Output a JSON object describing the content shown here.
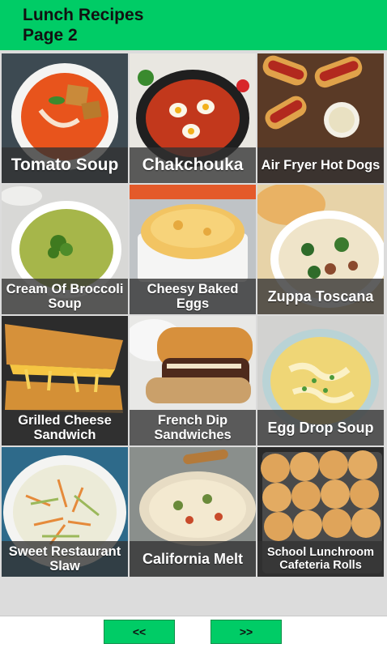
{
  "header": {
    "line1": "Lunch Recipes",
    "line2": "Page 2"
  },
  "recipes": [
    {
      "name": "Tomato Soup"
    },
    {
      "name": "Chakchouka"
    },
    {
      "name": "Air Fryer Hot Dogs"
    },
    {
      "name": "Cream Of Broccoli Soup"
    },
    {
      "name": "Cheesy Baked Eggs"
    },
    {
      "name": "Zuppa Toscana"
    },
    {
      "name": "Grilled Cheese Sandwich"
    },
    {
      "name": "French Dip Sandwiches"
    },
    {
      "name": "Egg Drop Soup"
    },
    {
      "name": "Sweet Restaurant Slaw"
    },
    {
      "name": "California Melt"
    },
    {
      "name": "School Lunchroom Cafeteria Rolls"
    }
  ],
  "nav": {
    "prev_label": "<<",
    "next_label": ">>"
  },
  "colors": {
    "accent": "#00cc66",
    "background": "#dcdcdc",
    "label_bg": "#323232"
  }
}
